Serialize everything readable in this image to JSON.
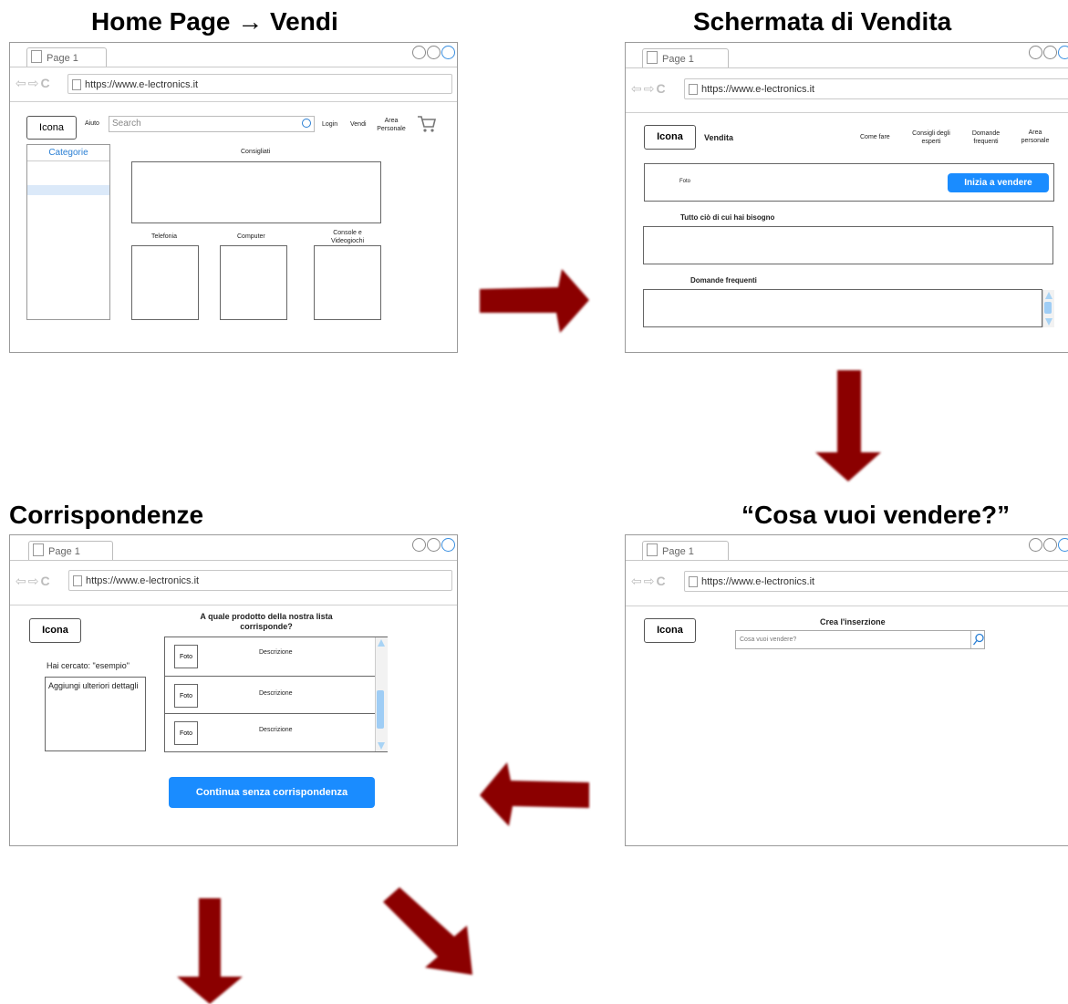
{
  "titles": {
    "home": "Home Page → Vendi",
    "vendita": "Schermata di Vendita",
    "corrispondenze": "Corrispondenze",
    "cosa": "“Cosa vuoi vendere?”"
  },
  "browser": {
    "tab_label": "Page 1",
    "url": "https://www.e-lectronics.it"
  },
  "home": {
    "logo": "Icona",
    "aiuto": "Aiuto",
    "search_placeholder": "Search",
    "login": "Login",
    "vendi": "Vendi",
    "area_personale": "Area Personale",
    "categorie": "Categorie",
    "consigliati": "Consigliati",
    "telefonia": "Telefonia",
    "computer": "Computer",
    "console": "Console e Videogiochi"
  },
  "vendita": {
    "logo": "Icona",
    "vendita": "Vendita",
    "come_fare": "Come fare",
    "consigli": "Consigli degli esperti",
    "domande_nav": "Domande frequenti",
    "area": "Area personale",
    "foto": "Foto",
    "inizia": "Inizia a vendere",
    "tutto": "Tutto ciò di cui hai bisogno",
    "domande": "Domande frequenti"
  },
  "cosa": {
    "logo": "Icona",
    "crea": "Crea l'inserzione",
    "placeholder": "Cosa vuoi vendere?"
  },
  "corr": {
    "logo": "Icona",
    "question": "A quale prodotto della nostra lista corrisponde?",
    "cercato": "Hai cercato: \"esempio\"",
    "dettagli": "Aggiungi ulteriori dettagli",
    "rows": [
      {
        "foto": "Foto",
        "descr": "Descrizione"
      },
      {
        "foto": "Foto",
        "descr": "Descrizione"
      },
      {
        "foto": "Foto",
        "descr": "Descrizione"
      }
    ],
    "continua": "Continua senza corrispondenza"
  },
  "colors": {
    "arrow": "#8b0000",
    "accent": "#1a8cff"
  }
}
